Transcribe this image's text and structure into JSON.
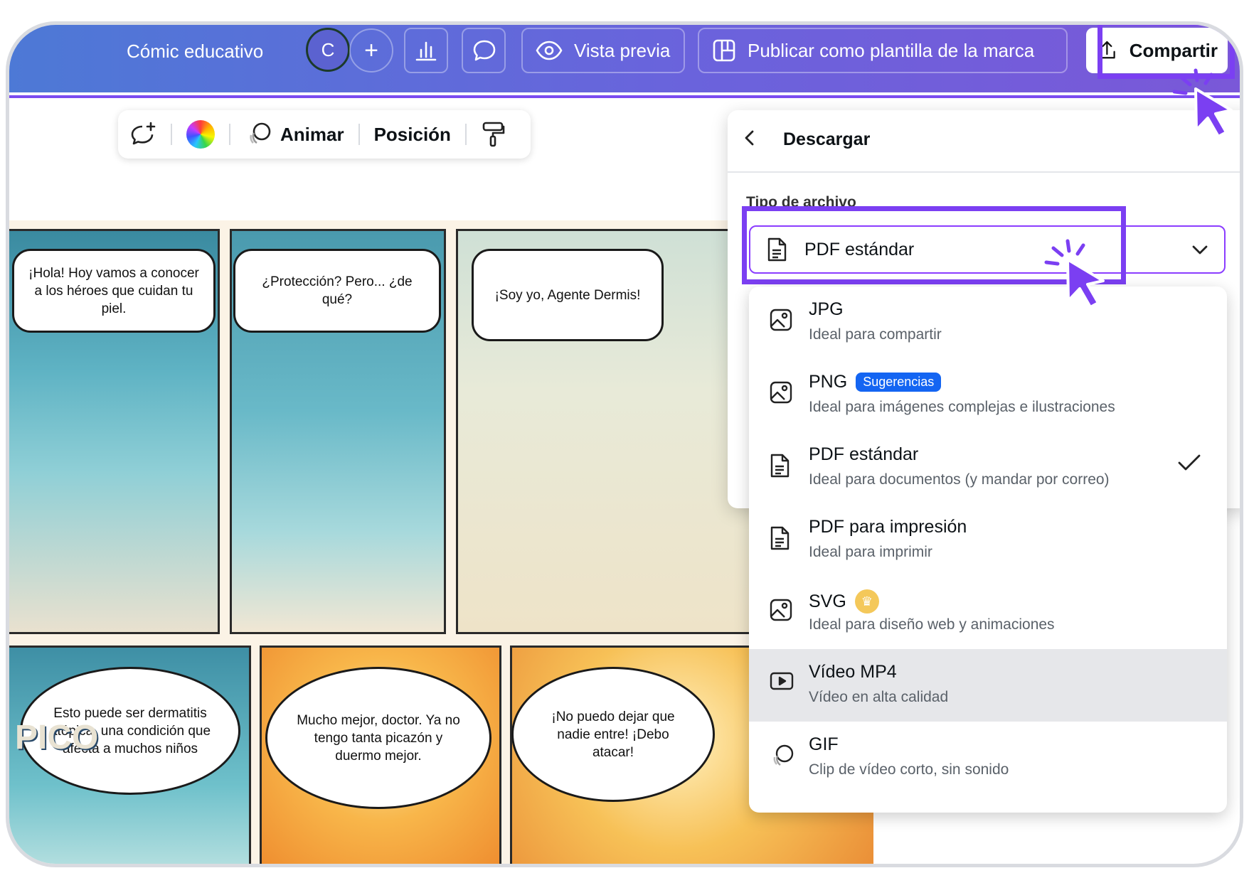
{
  "topbar": {
    "doc_title": "Cómic educativo",
    "avatar_initial": "C",
    "plus": "+",
    "preview_label": "Vista previa",
    "publish_label": "Publicar como plantilla de la marca",
    "share_label": "Compartir"
  },
  "element_toolbar": {
    "animate_label": "Animar",
    "position_label": "Posición"
  },
  "comic": {
    "bubbles": [
      "¡Hola! Hoy vamos a conocer a los héroes que cuidan tu piel.",
      "¿Protección? Pero... ¿de qué?",
      "¡Soy yo, Agente Dermis!",
      "Esto puede ser dermatitis atópica, una condición que afecta a muchos niños",
      "Mucho mejor, doctor. Ya no tengo tanta picazón y duermo mejor.",
      "¡No puedo dejar que nadie entre! ¡Debo atacar!"
    ],
    "sign_text": "PICO"
  },
  "download_panel": {
    "title": "Descargar",
    "file_type_label": "Tipo de archivo",
    "selected_value": "PDF estándar",
    "options": [
      {
        "name": "JPG",
        "desc": "Ideal para compartir",
        "icon": "image-icon"
      },
      {
        "name": "PNG",
        "badge": "Sugerencias",
        "desc": "Ideal para imágenes complejas e ilustraciones",
        "icon": "image-icon"
      },
      {
        "name": "PDF estándar",
        "desc": "Ideal para documentos (y mandar por correo)",
        "icon": "document-icon",
        "selected": true
      },
      {
        "name": "PDF para impresión",
        "desc": "Ideal para imprimir",
        "icon": "document-icon"
      },
      {
        "name": "SVG",
        "desc": "Ideal para diseño web y animaciones",
        "icon": "image-icon",
        "premium": true
      },
      {
        "name": "Vídeo MP4",
        "desc": "Vídeo en alta calidad",
        "icon": "video-icon",
        "hovered": true
      },
      {
        "name": "GIF",
        "desc": "Clip de vídeo corto, sin sonido",
        "icon": "gif-icon"
      }
    ]
  },
  "colors": {
    "accent": "#7b3ff2",
    "badge_blue": "#1465f2",
    "topbar_start": "#4d79d6",
    "topbar_end": "#7a58d8"
  }
}
